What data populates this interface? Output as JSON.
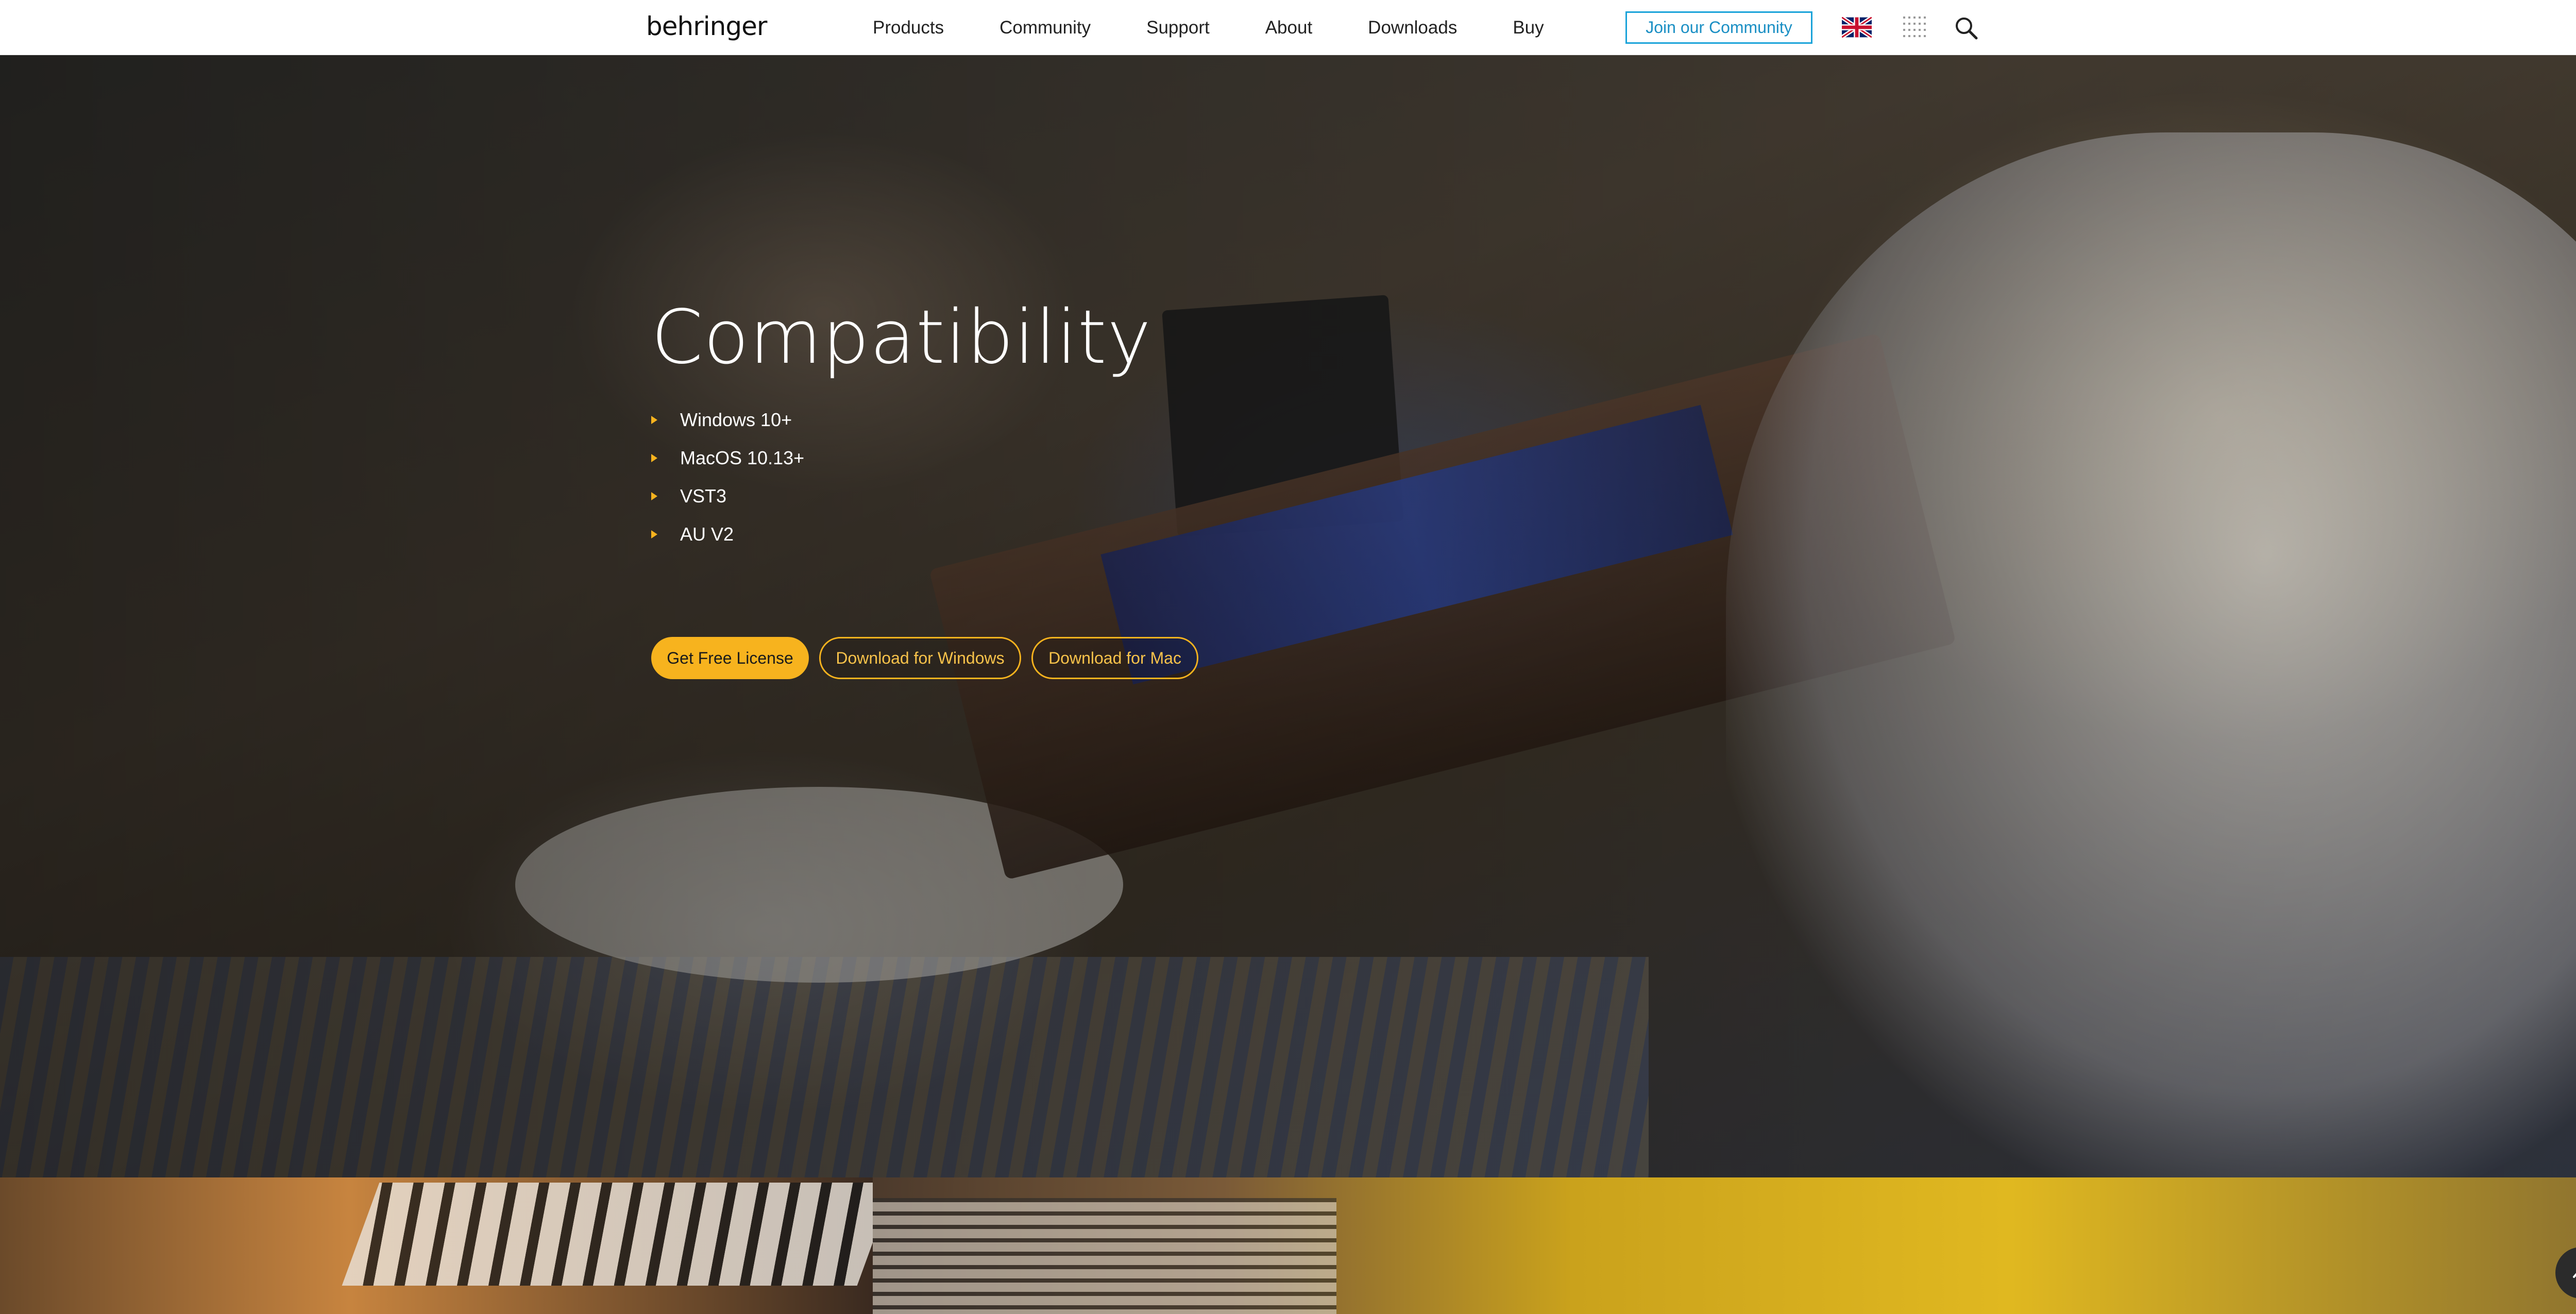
{
  "header": {
    "logo": "behringer",
    "nav": [
      "Products",
      "Community",
      "Support",
      "About",
      "Downloads",
      "Buy"
    ],
    "join_label": "Join our Community",
    "language_icon": "uk-flag-icon",
    "apps_icon": "apps-grid-icon",
    "search_icon": "search-icon"
  },
  "hero": {
    "title": "Compatibility",
    "os_list": [
      "Windows 10+",
      "MacOS 10.13+",
      "VST3",
      "AU V2"
    ],
    "buttons": {
      "license": "Get Free License",
      "windows": "Download for Windows",
      "mac": "Download for Mac"
    }
  },
  "colors": {
    "accent": "#f7b31e",
    "join_border": "#1aa3d9",
    "header_bg": "#ffffff"
  },
  "scroll_top_icon": "chevron-up-icon"
}
